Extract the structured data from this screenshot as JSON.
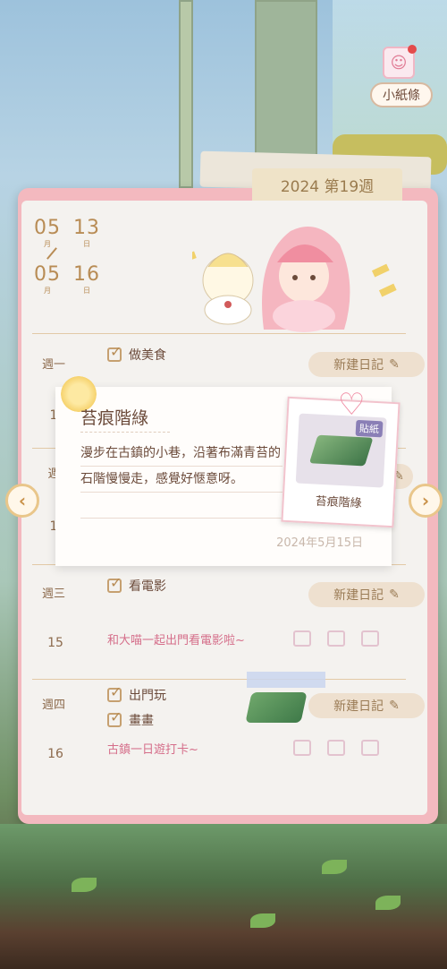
{
  "note_button": {
    "label": "小紙條",
    "icon": "note-portrait-icon"
  },
  "diary": {
    "week_tab": "2024 第19週",
    "date_range": {
      "start_month": "05",
      "start_day": "13",
      "end_month": "05",
      "end_day": "16",
      "month_unit": "月",
      "day_unit": "日"
    },
    "days": [
      {
        "weekday": "週一",
        "date": "",
        "todos": [
          "做美食"
        ],
        "new_entry": "新建日記",
        "diary_text": ""
      },
      {
        "weekday": "週二",
        "date": "1",
        "todos": [],
        "new_entry": "",
        "diary_text": ""
      },
      {
        "weekday": "週三",
        "date": "15",
        "todos": [
          "看電影"
        ],
        "new_entry": "新建日記",
        "diary_text": "和大喵一起出門看電影啦~"
      },
      {
        "weekday": "週四",
        "date": "16",
        "todos": [
          "出門玩",
          "畫畫"
        ],
        "new_entry": "新建日記",
        "diary_text": "古鎮一日遊打卡~"
      }
    ]
  },
  "popup": {
    "title": "苔痕階綠",
    "body": "漫步在古鎮的小巷，沿著布滿青苔的石階慢慢走，感覺好愜意呀。",
    "date": "2024年5月15日",
    "sticker": {
      "badge": "貼紙",
      "name": "苔痕階綠"
    }
  },
  "nav": {
    "prev_icon": "chevron-left-icon",
    "next_icon": "chevron-right-icon",
    "prev_glyph": "‹",
    "next_glyph": "›"
  },
  "colors": {
    "accent_pink": "#f3b9bf",
    "text_brown": "#6b4a3a",
    "diary_pink": "#d56e8a",
    "gold": "#b88c55"
  }
}
